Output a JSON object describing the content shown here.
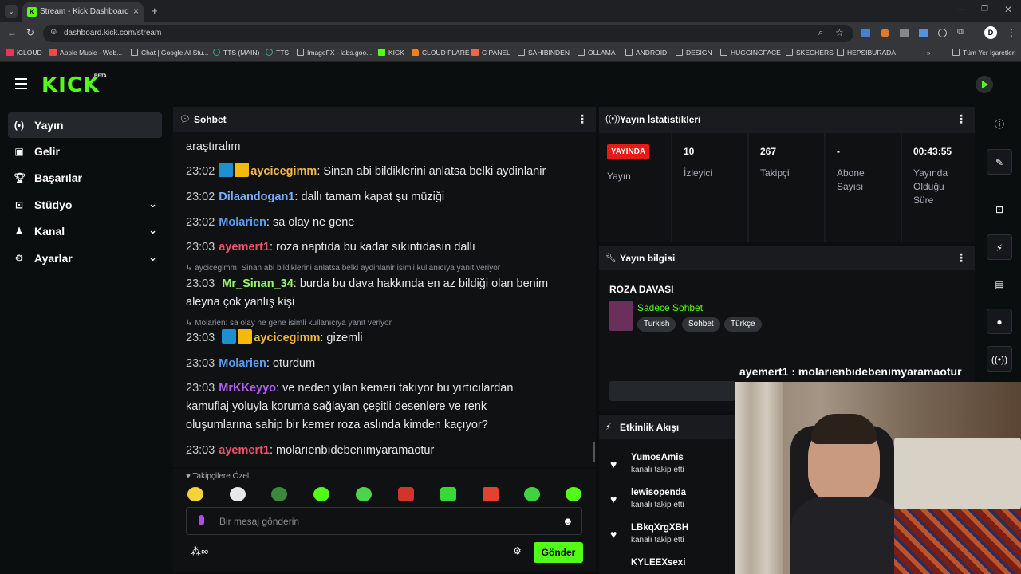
{
  "browser": {
    "tab_title": "Stream - Kick Dashboard",
    "url": "dashboard.kick.com/stream",
    "bookmarks": [
      "iCLOUD",
      "Apple Music - Web...",
      "Chat | Google AI Stu...",
      "TTS (MAIN)",
      "TTS",
      "ImageFX - labs.goo...",
      "KICK",
      "CLOUD FLARE",
      "C PANEL",
      "SAHIBINDEN",
      "OLLAMA",
      "ANDROID",
      "DESIGN",
      "HUGGINGFACE",
      "SKECHERS",
      "HEPSIBURADA",
      "Tüm Yer İşaretleri"
    ]
  },
  "app": {
    "logo": "KICK",
    "beta": "BETA",
    "accent": "#53fc18"
  },
  "sidebar": {
    "items": [
      {
        "label": "Yayın",
        "icon": "broadcast-icon"
      },
      {
        "label": "Gelir",
        "icon": "revenue-icon"
      },
      {
        "label": "Başarılar",
        "icon": "trophy-icon"
      },
      {
        "label": "Stüdyo",
        "icon": "studio-icon"
      },
      {
        "label": "Kanal",
        "icon": "channel-icon"
      },
      {
        "label": "Ayarlar",
        "icon": "gear-icon"
      }
    ]
  },
  "chat": {
    "title": "Sohbet",
    "first_line": "araştıralım",
    "messages": [
      {
        "time": "23:02",
        "user": "aycicegimm",
        "text": "Sinan abi bildiklerini anlatsa belki aydinlanir",
        "color": "#f5b942"
      },
      {
        "time": "23:02",
        "user": "Dilaandogan1",
        "text": "dallı tamam kapat şu müziği",
        "color": "#7ab0ff"
      },
      {
        "time": "23:02",
        "user": "Molarien",
        "text": "sa olay ne gene",
        "color": "#5b9df5"
      },
      {
        "time": "23:03",
        "user": "ayemert1",
        "text": "roza naptıda bu kadar sıkıntıdasın dallı",
        "color": "#f0506e"
      },
      {
        "time": "23:03",
        "user": "Mr_Sinan_34",
        "text": "burda bu dava hakkında en az bildiği olan benim",
        "text2": "aleyna çok yanlış kişi",
        "color": "#9cf26c"
      },
      {
        "time": "23:03",
        "user": "aycicegimm",
        "text": "gizemli",
        "color": "#f5b942"
      },
      {
        "time": "23:03",
        "user": "Molarien",
        "text": "oturdum",
        "color": "#5b9df5"
      },
      {
        "time": "23:03",
        "user": "MrKKeyyo",
        "text": "ve neden yılan kemeri takıyor bu yırtıcılardan",
        "text2": "kamuflaj yoluyla koruma sağlayan çeşitli desenlere ve renk",
        "text3": "oluşumlarına sahip bir kemer roza aslında kimden kaçıyor?",
        "color": "#b45cf2"
      },
      {
        "time": "23:03",
        "user": "ayemert1",
        "text": "molarıenbıdebenımyaramaotur",
        "color": "#f0506e"
      }
    ],
    "reply1": "aycicegimm: Sinan abi bildiklerini anlatsa belki aydinlanir isimli kullanıcıya yanıt veriyor",
    "reply2": "Molarien: sa olay ne gene isimli kullanıcıya yanıt veriyor",
    "followers_only": "Takipçilere Özel",
    "placeholder": "Bir mesaj gönderin",
    "send": "Gönder"
  },
  "stats": {
    "title": "Yayın İstatistikleri",
    "live": "YAYINDA",
    "live_label": "Yayın",
    "viewers": "10",
    "viewers_label": "İzleyici",
    "followers": "267",
    "followers_label": "Takipçi",
    "subs": "-",
    "subs_label": "Abone Sayısı",
    "uptime": "00:43:55",
    "uptime_label": "Yayında Olduğu Süre"
  },
  "info": {
    "title": "Yayın bilgisi",
    "stream_title": "ROZA DAVASI",
    "category": "Sadece Sohbet",
    "tags": [
      "Turkish",
      "Sohbet",
      "Türkçe"
    ],
    "overlay": "ayemert1 : molarıenbıdebenımyaramaotur"
  },
  "activity": {
    "title": "Etkinlik Akışı",
    "items": [
      {
        "user": "YumosAmis",
        "text": "kanalı takip etti"
      },
      {
        "user": "lewisopenda",
        "text": "kanalı takip etti"
      },
      {
        "user": "LBkqXrgXBH",
        "text": "kanalı takip etti"
      },
      {
        "user": "KYLEEXsexi",
        "text": ""
      }
    ]
  }
}
